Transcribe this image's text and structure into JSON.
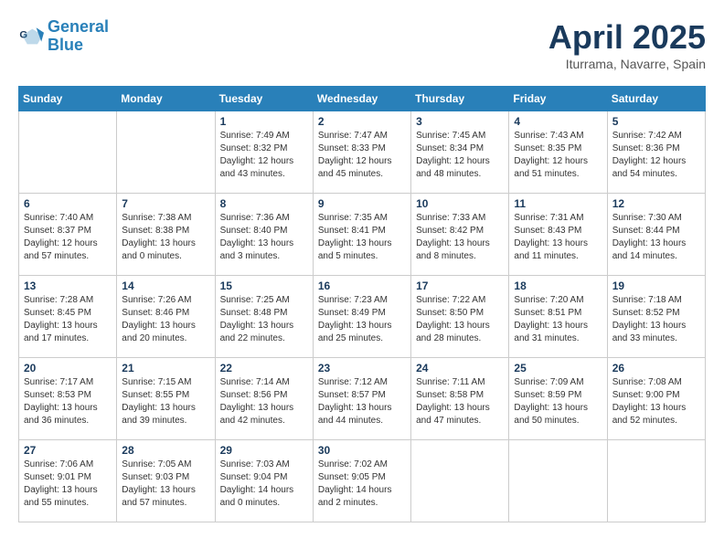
{
  "header": {
    "logo_line1": "General",
    "logo_line2": "Blue",
    "month_title": "April 2025",
    "location": "Iturrama, Navarre, Spain"
  },
  "weekdays": [
    "Sunday",
    "Monday",
    "Tuesday",
    "Wednesday",
    "Thursday",
    "Friday",
    "Saturday"
  ],
  "weeks": [
    [
      {
        "day": "",
        "info": ""
      },
      {
        "day": "",
        "info": ""
      },
      {
        "day": "1",
        "info": "Sunrise: 7:49 AM\nSunset: 8:32 PM\nDaylight: 12 hours and 43 minutes."
      },
      {
        "day": "2",
        "info": "Sunrise: 7:47 AM\nSunset: 8:33 PM\nDaylight: 12 hours and 45 minutes."
      },
      {
        "day": "3",
        "info": "Sunrise: 7:45 AM\nSunset: 8:34 PM\nDaylight: 12 hours and 48 minutes."
      },
      {
        "day": "4",
        "info": "Sunrise: 7:43 AM\nSunset: 8:35 PM\nDaylight: 12 hours and 51 minutes."
      },
      {
        "day": "5",
        "info": "Sunrise: 7:42 AM\nSunset: 8:36 PM\nDaylight: 12 hours and 54 minutes."
      }
    ],
    [
      {
        "day": "6",
        "info": "Sunrise: 7:40 AM\nSunset: 8:37 PM\nDaylight: 12 hours and 57 minutes."
      },
      {
        "day": "7",
        "info": "Sunrise: 7:38 AM\nSunset: 8:38 PM\nDaylight: 13 hours and 0 minutes."
      },
      {
        "day": "8",
        "info": "Sunrise: 7:36 AM\nSunset: 8:40 PM\nDaylight: 13 hours and 3 minutes."
      },
      {
        "day": "9",
        "info": "Sunrise: 7:35 AM\nSunset: 8:41 PM\nDaylight: 13 hours and 5 minutes."
      },
      {
        "day": "10",
        "info": "Sunrise: 7:33 AM\nSunset: 8:42 PM\nDaylight: 13 hours and 8 minutes."
      },
      {
        "day": "11",
        "info": "Sunrise: 7:31 AM\nSunset: 8:43 PM\nDaylight: 13 hours and 11 minutes."
      },
      {
        "day": "12",
        "info": "Sunrise: 7:30 AM\nSunset: 8:44 PM\nDaylight: 13 hours and 14 minutes."
      }
    ],
    [
      {
        "day": "13",
        "info": "Sunrise: 7:28 AM\nSunset: 8:45 PM\nDaylight: 13 hours and 17 minutes."
      },
      {
        "day": "14",
        "info": "Sunrise: 7:26 AM\nSunset: 8:46 PM\nDaylight: 13 hours and 20 minutes."
      },
      {
        "day": "15",
        "info": "Sunrise: 7:25 AM\nSunset: 8:48 PM\nDaylight: 13 hours and 22 minutes."
      },
      {
        "day": "16",
        "info": "Sunrise: 7:23 AM\nSunset: 8:49 PM\nDaylight: 13 hours and 25 minutes."
      },
      {
        "day": "17",
        "info": "Sunrise: 7:22 AM\nSunset: 8:50 PM\nDaylight: 13 hours and 28 minutes."
      },
      {
        "day": "18",
        "info": "Sunrise: 7:20 AM\nSunset: 8:51 PM\nDaylight: 13 hours and 31 minutes."
      },
      {
        "day": "19",
        "info": "Sunrise: 7:18 AM\nSunset: 8:52 PM\nDaylight: 13 hours and 33 minutes."
      }
    ],
    [
      {
        "day": "20",
        "info": "Sunrise: 7:17 AM\nSunset: 8:53 PM\nDaylight: 13 hours and 36 minutes."
      },
      {
        "day": "21",
        "info": "Sunrise: 7:15 AM\nSunset: 8:55 PM\nDaylight: 13 hours and 39 minutes."
      },
      {
        "day": "22",
        "info": "Sunrise: 7:14 AM\nSunset: 8:56 PM\nDaylight: 13 hours and 42 minutes."
      },
      {
        "day": "23",
        "info": "Sunrise: 7:12 AM\nSunset: 8:57 PM\nDaylight: 13 hours and 44 minutes."
      },
      {
        "day": "24",
        "info": "Sunrise: 7:11 AM\nSunset: 8:58 PM\nDaylight: 13 hours and 47 minutes."
      },
      {
        "day": "25",
        "info": "Sunrise: 7:09 AM\nSunset: 8:59 PM\nDaylight: 13 hours and 50 minutes."
      },
      {
        "day": "26",
        "info": "Sunrise: 7:08 AM\nSunset: 9:00 PM\nDaylight: 13 hours and 52 minutes."
      }
    ],
    [
      {
        "day": "27",
        "info": "Sunrise: 7:06 AM\nSunset: 9:01 PM\nDaylight: 13 hours and 55 minutes."
      },
      {
        "day": "28",
        "info": "Sunrise: 7:05 AM\nSunset: 9:03 PM\nDaylight: 13 hours and 57 minutes."
      },
      {
        "day": "29",
        "info": "Sunrise: 7:03 AM\nSunset: 9:04 PM\nDaylight: 14 hours and 0 minutes."
      },
      {
        "day": "30",
        "info": "Sunrise: 7:02 AM\nSunset: 9:05 PM\nDaylight: 14 hours and 2 minutes."
      },
      {
        "day": "",
        "info": ""
      },
      {
        "day": "",
        "info": ""
      },
      {
        "day": "",
        "info": ""
      }
    ]
  ]
}
